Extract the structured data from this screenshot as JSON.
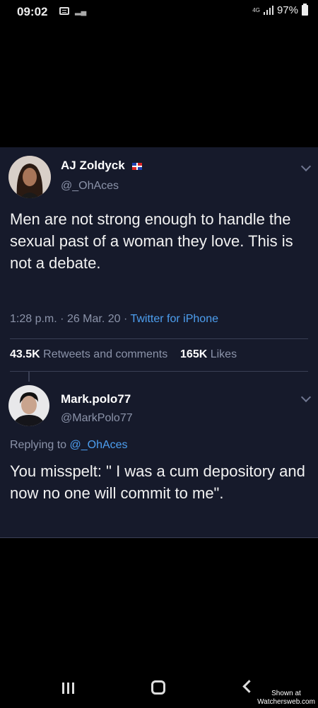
{
  "status_bar": {
    "time": "09:02",
    "network": "4G",
    "battery": "97%",
    "icons": [
      "message-icon",
      "signal-icon",
      "battery-icon"
    ]
  },
  "tweet": {
    "display_name": "AJ Zoldyck",
    "handle": "@_OhAces",
    "text": "Men are not strong enough to handle the sexual past of a woman they love. This is not a debate.",
    "time": "1:28 p.m.",
    "date": "26 Mar. 20",
    "source": "Twitter for iPhone",
    "retweets_count": "43.5K",
    "retweets_label": "Retweets and comments",
    "likes_count": "165K",
    "likes_label": "Likes"
  },
  "reply": {
    "display_name": "Mark.polo77",
    "handle": "@MarkPolo77",
    "replying_label": "Replying to",
    "replying_to": "@_OhAces",
    "text": "You misspelt: \" I was a cum depository and now no one will commit to me\"."
  },
  "watermark": {
    "line1": "Shown at",
    "line2": "Watchersweb.com"
  },
  "colors": {
    "background": "#000000",
    "card": "#161a2b",
    "link": "#4d9ff0",
    "muted": "#8b93a9"
  }
}
